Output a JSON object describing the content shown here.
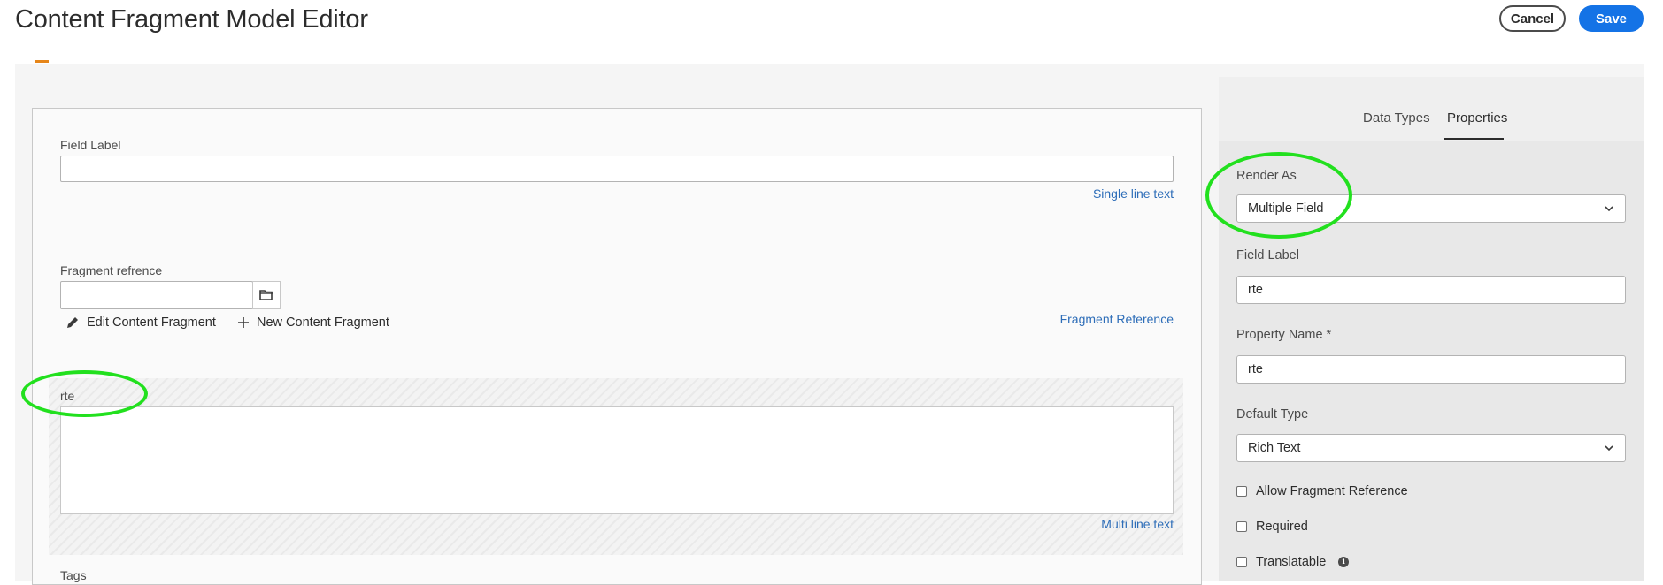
{
  "header": {
    "title": "Content Fragment Model Editor",
    "cancel_label": "Cancel",
    "save_label": "Save"
  },
  "canvas": {
    "field_label": {
      "label": "Field Label",
      "type_link": "Single line text"
    },
    "fragment_reference": {
      "label": "Fragment refrence",
      "edit_action": "Edit Content Fragment",
      "new_action": "New Content Fragment",
      "type_link": "Fragment Reference"
    },
    "rte": {
      "label": "rte",
      "type_link": "Multi line text"
    },
    "tags": {
      "label": "Tags"
    }
  },
  "panel": {
    "tabs": [
      {
        "label": "Data Types",
        "selected": false
      },
      {
        "label": "Properties",
        "selected": true
      }
    ],
    "render_as": {
      "label": "Render As",
      "value": "Multiple Field"
    },
    "field_label": {
      "label": "Field Label",
      "value": "rte"
    },
    "property_name": {
      "label": "Property Name *",
      "value": "rte"
    },
    "default_type": {
      "label": "Default Type",
      "value": "Rich Text"
    },
    "checkboxes": [
      {
        "label": "Allow Fragment Reference",
        "checked": false
      },
      {
        "label": "Required",
        "checked": false
      },
      {
        "label": "Translatable",
        "checked": false
      }
    ]
  },
  "colors": {
    "accent": "#1473e6",
    "link": "#2d6db8",
    "annotation": "#22e01e"
  },
  "icons": [
    "folder-icon",
    "pencil-icon",
    "plus-icon",
    "chevron-down-icon",
    "info-icon"
  ]
}
